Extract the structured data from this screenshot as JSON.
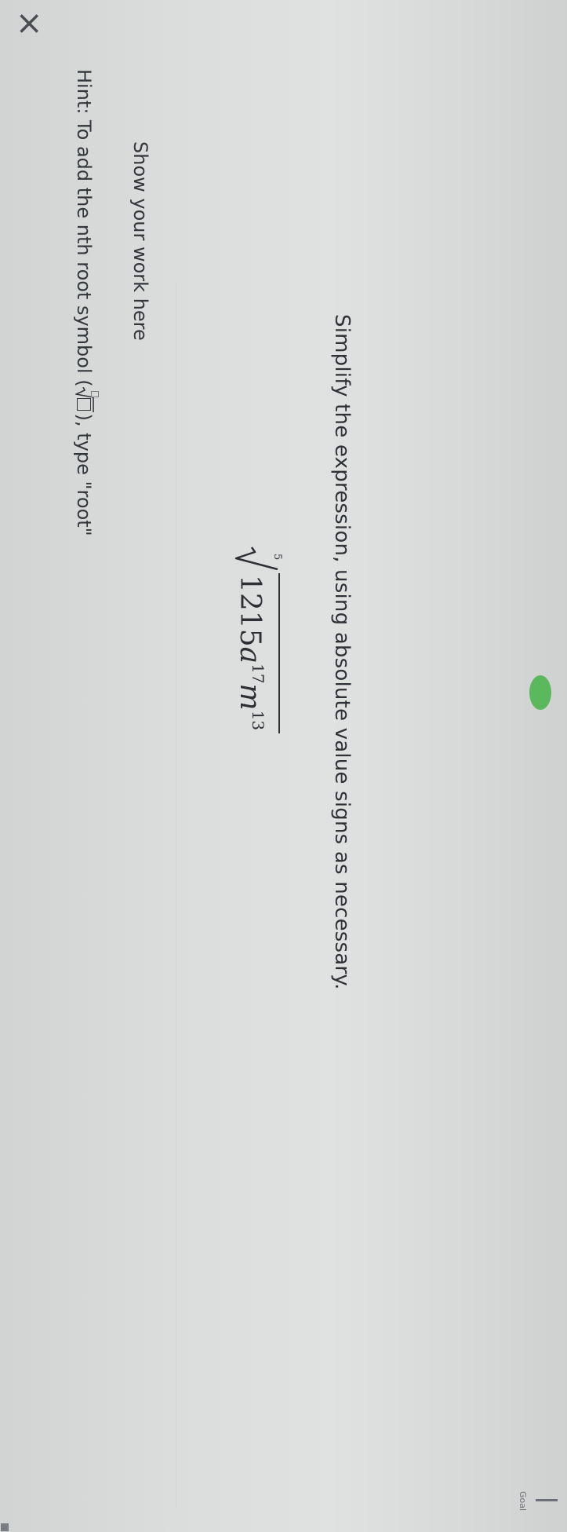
{
  "app": {
    "close_icon": "close-icon",
    "progress_color": "#5cb85c",
    "goal_label": "Goal"
  },
  "question": {
    "prompt": "Simplify the expression, using absolute value signs as necessary.",
    "expression": {
      "root_index": "5",
      "coefficient": "1215",
      "var1": "a",
      "exp1": "17",
      "var2": "m",
      "exp2": "13"
    }
  },
  "work": {
    "label": "Show your work here",
    "hint_prefix": "Hint: To add the nth root symbol (",
    "hint_suffix": "), type \"root\""
  }
}
